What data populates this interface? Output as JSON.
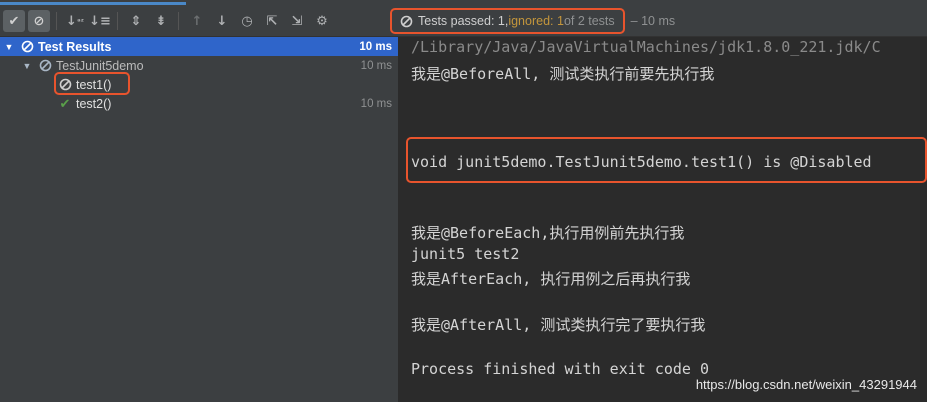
{
  "toolbar": {
    "buttons": [
      {
        "name": "show-passed-icon",
        "glyph": "✔",
        "active": true
      },
      {
        "name": "show-ignored-icon",
        "glyph": "⊘",
        "active": true
      },
      {
        "name": "sort-alpha-icon",
        "glyph": "↓₂",
        "active": false
      },
      {
        "name": "sort-duration-icon",
        "glyph": "↓≡",
        "active": false
      },
      {
        "name": "expand-all-icon",
        "glyph": "⇕",
        "active": false
      },
      {
        "name": "collapse-all-icon",
        "glyph": "⇟",
        "active": false
      },
      {
        "name": "prev-failed-icon",
        "glyph": "↑",
        "active": false,
        "dim": true
      },
      {
        "name": "next-failed-icon",
        "glyph": "↓",
        "active": false
      },
      {
        "name": "history-icon",
        "glyph": "◷",
        "active": false
      },
      {
        "name": "import-tests-icon",
        "glyph": "⇱",
        "active": false
      },
      {
        "name": "export-tests-icon",
        "glyph": "⇲",
        "active": false
      },
      {
        "name": "settings-gear-icon",
        "glyph": "⚙",
        "active": false
      }
    ]
  },
  "status": {
    "passed": "Tests passed: 1, ",
    "ignored": "ignored: 1",
    "of": " of 2 tests",
    "time": "– 10 ms"
  },
  "tree": {
    "root": {
      "label": "Test Results",
      "time": "10 ms"
    },
    "suite": {
      "label": "TestJunit5demo",
      "time": "10 ms"
    },
    "tests": [
      {
        "label": "test1()",
        "time": "",
        "status": "ignored"
      },
      {
        "label": "test2()",
        "time": "10 ms",
        "status": "passed"
      }
    ]
  },
  "console": {
    "lines": [
      "/Library/Java/JavaVirtualMachines/jdk1.8.0_221.jdk/C",
      "我是@BeforeAll, 测试类执行前要先执行我",
      "void junit5demo.TestJunit5demo.test1() is @Disabled",
      "我是@BeforeEach,执行用例前先执行我",
      "junit5 test2",
      "我是AfterEach, 执行用例之后再执行我",
      "我是@AfterAll, 测试类执行完了要执行我",
      "Process finished with exit code 0"
    ]
  },
  "watermark": "https://blog.csdn.net/weixin_43291944",
  "colors": {
    "accent": "#2f65ca",
    "highlight": "#e8542d",
    "passed": "#5aa04a",
    "ignored": "#c4963c"
  }
}
